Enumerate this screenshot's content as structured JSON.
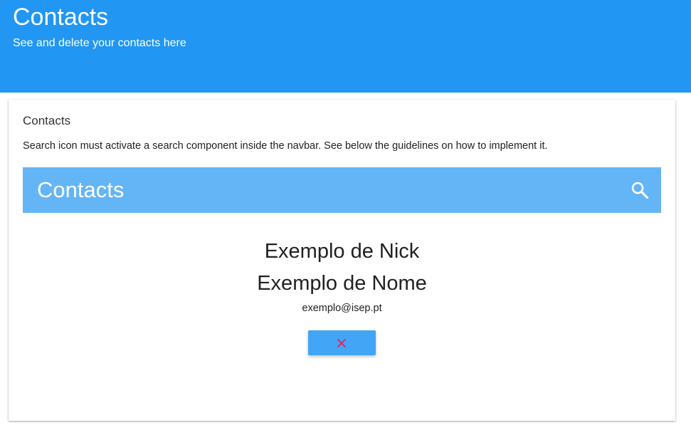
{
  "header": {
    "title": "Contacts",
    "subtitle": "See and delete your contacts here"
  },
  "card": {
    "title": "Contacts",
    "description": "Search icon must activate a search component inside the navbar. See below the guidelines on how to implement it."
  },
  "navbar": {
    "title": "Contacts",
    "search_icon": "search-icon"
  },
  "contact": {
    "nick": "Exemplo de Nick",
    "name": "Exemplo de Nome",
    "email": "exemplo@isep.pt",
    "delete_icon": "close-icon"
  },
  "colors": {
    "header_bg": "#2196f3",
    "navbar_bg": "#64b5f6",
    "button_bg": "#42a5f5",
    "delete_icon": "#e91e63"
  }
}
